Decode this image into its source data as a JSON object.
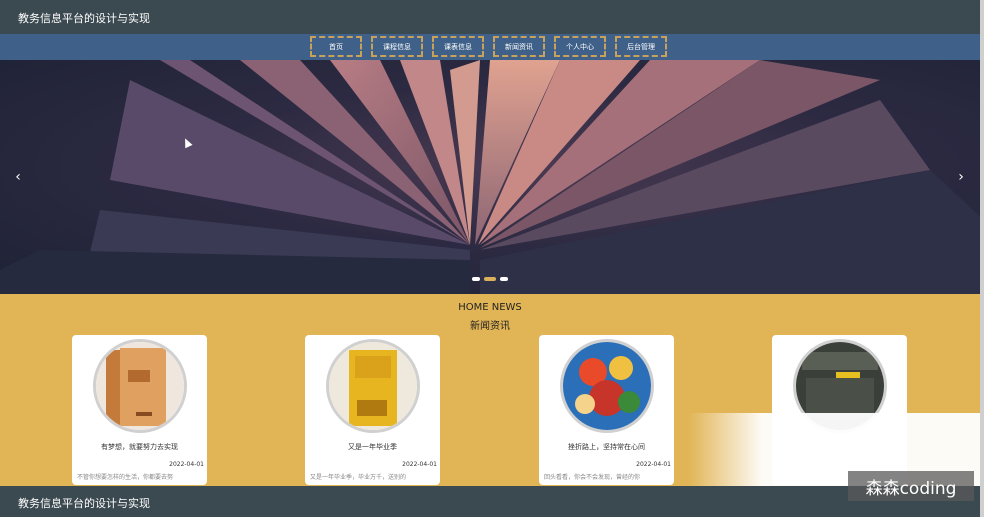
{
  "header": {
    "site_title": "教务信息平台的设计与实现"
  },
  "nav": {
    "items": [
      {
        "label": "首页"
      },
      {
        "label": "课程信息"
      },
      {
        "label": "课表信息"
      },
      {
        "label": "新闻资讯"
      },
      {
        "label": "个人中心"
      },
      {
        "label": "后台管理"
      }
    ]
  },
  "banner": {
    "prev_icon": "chevron-left-icon",
    "next_icon": "chevron-right-icon",
    "prev_glyph": "‹",
    "next_glyph": "›",
    "slide_count": 3,
    "active_slide": 2
  },
  "news": {
    "en_title": "HOME NEWS",
    "cn_title": "新闻资讯",
    "items": [
      {
        "title": "有梦想，就要努力去实现",
        "date": "2022-04-01",
        "excerpt": "不管你想要怎样的生活，你都要去努"
      },
      {
        "title": "又是一年毕业季",
        "date": "2022-04-01",
        "excerpt": "又是一年毕业季，毕业万千，送别的"
      },
      {
        "title": "挫折路上，坚持常在心间",
        "date": "2022-04-01",
        "excerpt": "回头看看，你会不会发现，曾经的你"
      },
      {
        "title": "",
        "date": "",
        "excerpt": ""
      }
    ]
  },
  "footer": {
    "text": "教务信息平台的设计与实现"
  },
  "watermark": {
    "text": "森森coding"
  },
  "colors": {
    "header_bg": "#3b4950",
    "nav_bg": "#3f6189",
    "nav_border": "#c8a15a",
    "news_bg": "#e1b455",
    "dot_active": "#d9b15b"
  }
}
